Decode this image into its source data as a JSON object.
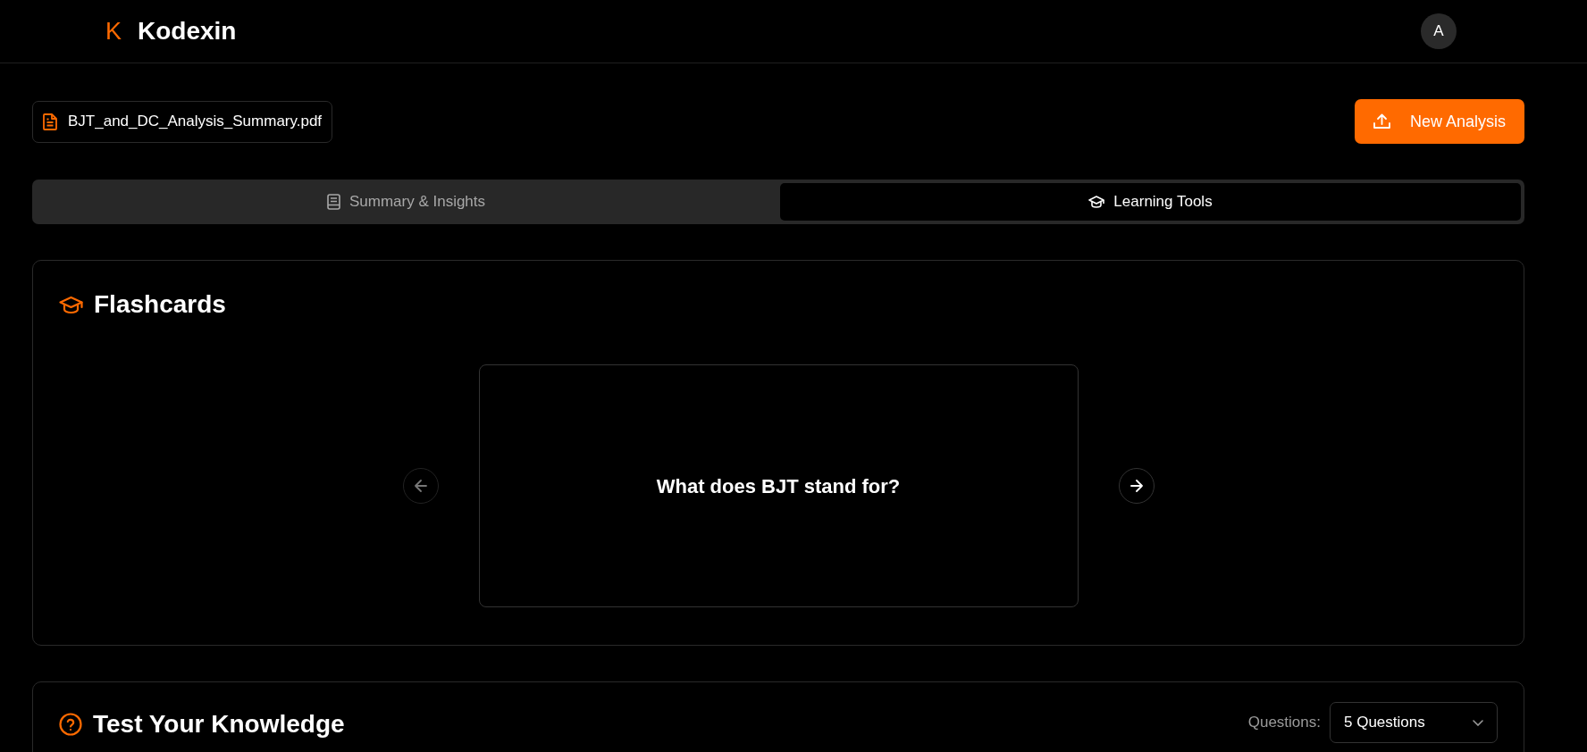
{
  "header": {
    "logo_letter": "K",
    "brand": "Kodexin",
    "avatar_initial": "A"
  },
  "file": {
    "name": "BJT_and_DC_Analysis_Summary.pdf"
  },
  "new_analysis_button": "New Analysis",
  "tabs": [
    {
      "label": "Summary & Insights",
      "kind": "book",
      "selected": false
    },
    {
      "label": "Learning Tools",
      "kind": "cap",
      "selected": true
    }
  ],
  "flashcards": {
    "title": "Flashcards",
    "card_text": "What does BJT stand for?",
    "prev_disabled": true
  },
  "quiz": {
    "title": "Test Your Knowledge",
    "questions_label": "Questions:",
    "questions_value": "5 Questions"
  }
}
